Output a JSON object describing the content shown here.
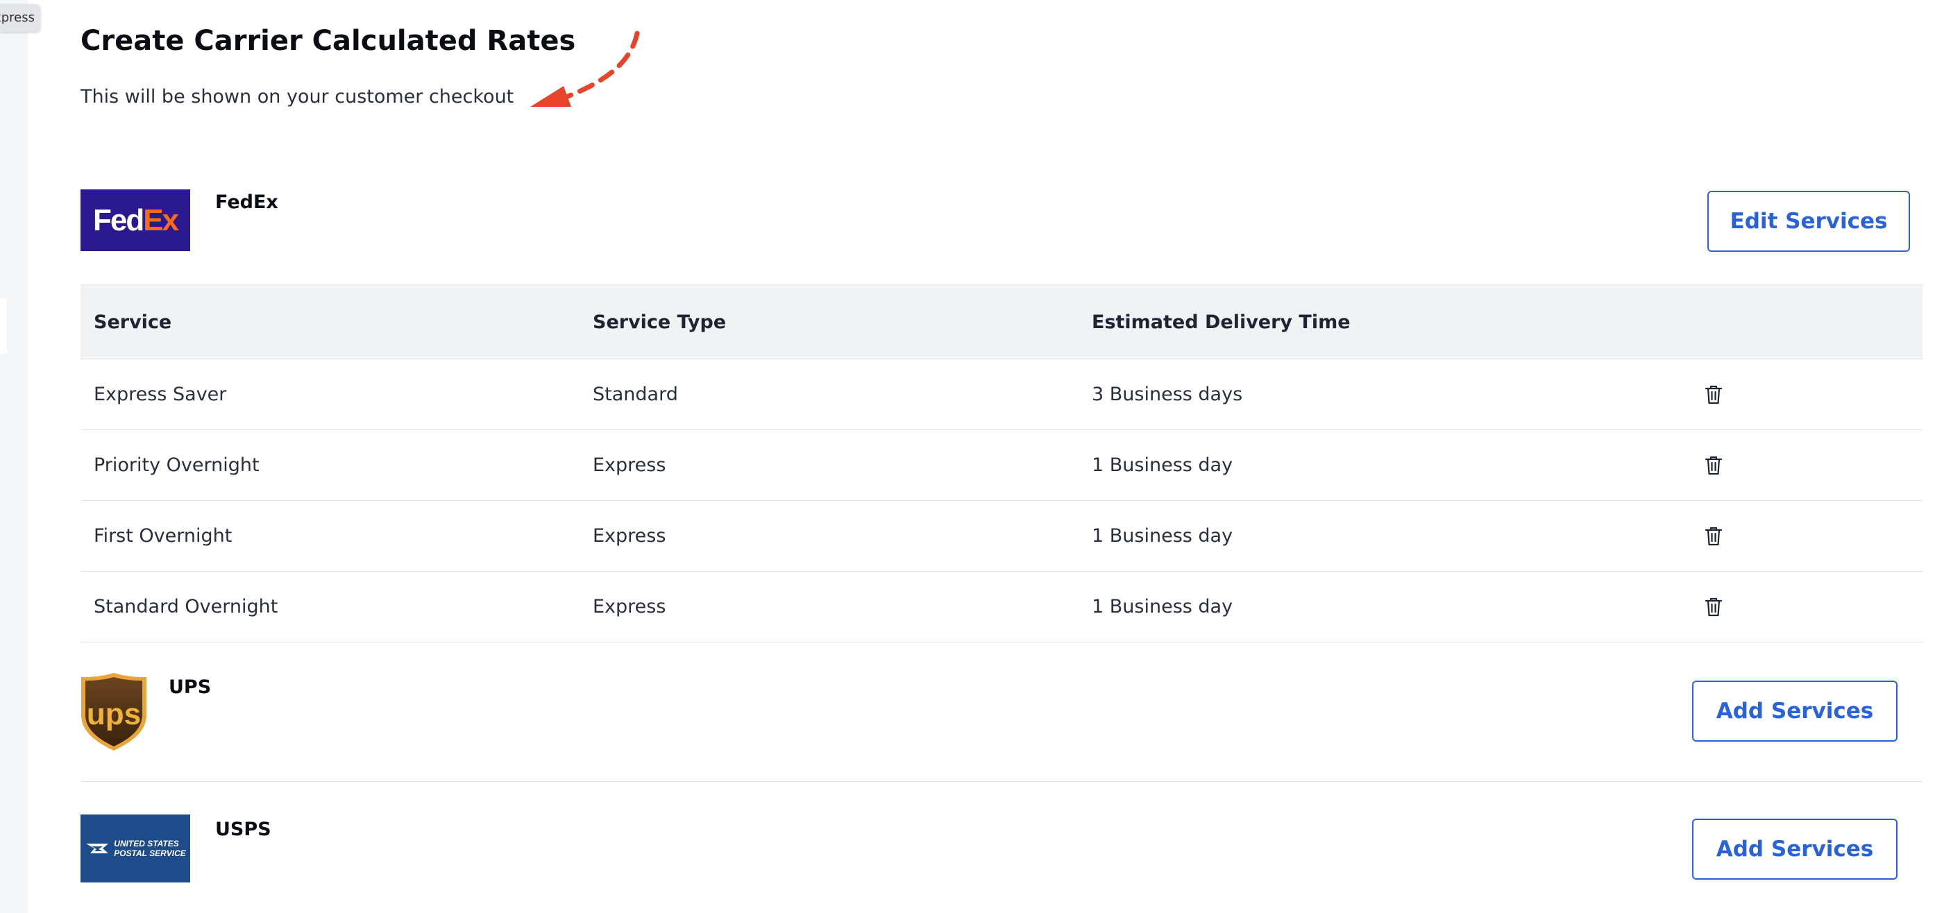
{
  "tooltip": {
    "text": "Express"
  },
  "header": {
    "title": "Create Carrier Calculated Rates",
    "subtitle": "This will be shown on your customer checkout"
  },
  "annotation": {
    "arrow_color": "#e8442a"
  },
  "carriers": {
    "fedex": {
      "name": "FedEx",
      "logo_fed": "Fed",
      "logo_ex": "Ex",
      "button_label": "Edit Services",
      "table": {
        "headers": [
          "Service",
          "Service Type",
          "Estimated Delivery Time"
        ],
        "rows": [
          [
            "Express Saver",
            "Standard",
            "3 Business days"
          ],
          [
            "Priority Overnight",
            "Express",
            "1 Business day"
          ],
          [
            "First Overnight",
            "Express",
            "1 Business day"
          ],
          [
            "Standard Overnight",
            "Express",
            "1 Business day"
          ]
        ]
      }
    },
    "ups": {
      "name": "UPS",
      "button_label": "Add Services",
      "logo_text": "ups"
    },
    "usps": {
      "name": "USPS",
      "button_label": "Add Services",
      "logo_line1": "UNITED STATES",
      "logo_line2": "POSTAL SERVICE"
    }
  },
  "colors": {
    "accent": "#2a63d9",
    "fedex_purple": "#2b1a8f",
    "fedex_orange": "#ff6a1a",
    "usps_blue": "#1e4b8a",
    "ups_brown": "#4a2e13",
    "ups_gold": "#f0b33a"
  },
  "icons": {
    "delete": "trash-icon",
    "annotation": "dashed-arrow-icon"
  }
}
